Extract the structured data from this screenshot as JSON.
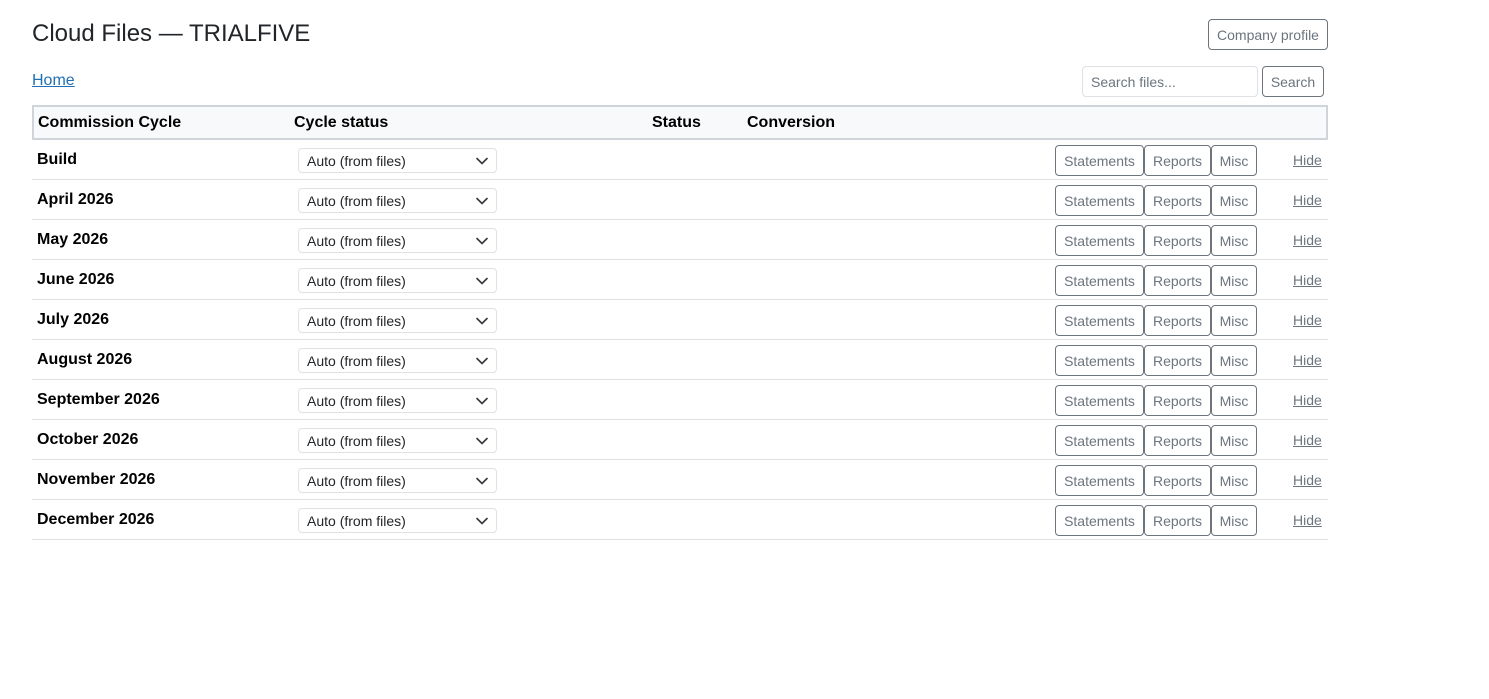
{
  "header": {
    "title": "Cloud Files — TRIALFIVE",
    "company_profile_label": "Company profile"
  },
  "nav": {
    "home_label": "Home"
  },
  "search": {
    "placeholder": "Search files...",
    "button_label": "Search"
  },
  "table": {
    "columns": [
      "Commission Cycle",
      "Cycle status",
      "Status",
      "Conversion"
    ],
    "rows": [
      {
        "cycle": "Build",
        "cycle_status": "Auto (from files)",
        "status": "",
        "conversion": ""
      },
      {
        "cycle": "April 2026",
        "cycle_status": "Auto (from files)",
        "status": "",
        "conversion": ""
      },
      {
        "cycle": "May 2026",
        "cycle_status": "Auto (from files)",
        "status": "",
        "conversion": ""
      },
      {
        "cycle": "June 2026",
        "cycle_status": "Auto (from files)",
        "status": "",
        "conversion": ""
      },
      {
        "cycle": "July 2026",
        "cycle_status": "Auto (from files)",
        "status": "",
        "conversion": ""
      },
      {
        "cycle": "August 2026",
        "cycle_status": "Auto (from files)",
        "status": "",
        "conversion": ""
      },
      {
        "cycle": "September 2026",
        "cycle_status": "Auto (from files)",
        "status": "",
        "conversion": ""
      },
      {
        "cycle": "October 2026",
        "cycle_status": "Auto (from files)",
        "status": "",
        "conversion": ""
      },
      {
        "cycle": "November 2026",
        "cycle_status": "Auto (from files)",
        "status": "",
        "conversion": ""
      },
      {
        "cycle": "December 2026",
        "cycle_status": "Auto (from files)",
        "status": "",
        "conversion": ""
      }
    ],
    "row_actions": {
      "statements_label": "Statements",
      "reports_label": "Reports",
      "misc_label": "Misc",
      "hide_label": "Hide"
    }
  },
  "icons": {
    "select_chevron": "chevron-down-icon"
  },
  "colors": {
    "link": "#1f6fb2",
    "button_outline": "#6c757d",
    "header_bg": "#f8f9fa"
  }
}
